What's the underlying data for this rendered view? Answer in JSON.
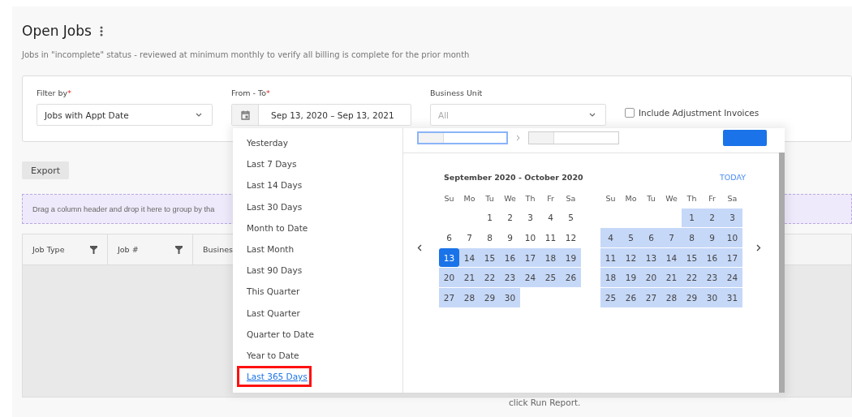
{
  "title": "Open Jobs",
  "subtitle": "Jobs in \"incomplete\" status - reviewed at minimum monthly to verify all billing is complete for the prior month",
  "filters": [
    {
      "label": "Filter by",
      "required": true,
      "kind": "select",
      "value": "Jobs with Appt Date"
    },
    {
      "label": "From - To",
      "required": true,
      "kind": "daterange",
      "value": "Sep 13, 2020 – Sep 13, 2021"
    },
    {
      "label": "Business Unit",
      "required": false,
      "kind": "select",
      "placeholder": "All"
    }
  ],
  "required_mark": "*",
  "include_adjustment": {
    "label": "Include Adjustment Invoices",
    "checked": false
  },
  "export_button": "Export",
  "group_panel": "Drag a column header and drop it here to group by tha",
  "columns": [
    {
      "label": "Job Type",
      "filter": true
    },
    {
      "label": "Job #",
      "filter": true
    },
    {
      "label": "Busines",
      "filter": false
    }
  ],
  "empty_message": "click Run Report.",
  "presets": [
    {
      "label": "Yesterday",
      "selected": false,
      "highlighted": false
    },
    {
      "label": "Last 7 Days",
      "selected": false,
      "highlighted": false
    },
    {
      "label": "Last 14 Days",
      "selected": false,
      "highlighted": false
    },
    {
      "label": "Last 30 Days",
      "selected": false,
      "highlighted": false
    },
    {
      "label": "Month to Date",
      "selected": false,
      "highlighted": false
    },
    {
      "label": "Last Month",
      "selected": false,
      "highlighted": false
    },
    {
      "label": "Last 90 Days",
      "selected": false,
      "highlighted": false
    },
    {
      "label": "This Quarter",
      "selected": false,
      "highlighted": false
    },
    {
      "label": "Last Quarter",
      "selected": false,
      "highlighted": false
    },
    {
      "label": "Quarter to Date",
      "selected": false,
      "highlighted": false
    },
    {
      "label": "Year to Date",
      "selected": false,
      "highlighted": false
    },
    {
      "label": "Last 365 Days",
      "selected": true,
      "highlighted": true
    }
  ],
  "calendar": {
    "range_title": "September 2020 - October 2020",
    "today": "TODAY",
    "months": [
      {
        "weekdays": [
          "Su",
          "Mo",
          "Tu",
          "We",
          "Th",
          "Fr",
          "Sa"
        ],
        "weeks": [
          {
            "kind": "leading",
            "days": [
              {
                "day": "1",
                "in_range": false,
                "selected": false
              },
              {
                "day": "2",
                "in_range": false,
                "selected": false
              },
              {
                "day": "3",
                "in_range": false,
                "selected": false
              },
              {
                "day": "4",
                "in_range": false,
                "selected": false
              },
              {
                "day": "5",
                "in_range": false,
                "selected": false
              }
            ]
          },
          {
            "days": [
              {
                "day": "6",
                "in_range": false,
                "selected": false
              },
              {
                "day": "7",
                "in_range": false,
                "selected": false
              },
              {
                "day": "8",
                "in_range": false,
                "selected": false
              },
              {
                "day": "9",
                "in_range": false,
                "selected": false
              },
              {
                "day": "10",
                "in_range": false,
                "selected": false
              },
              {
                "day": "11",
                "in_range": false,
                "selected": false
              },
              {
                "day": "12",
                "in_range": false,
                "selected": false
              }
            ]
          },
          {
            "days": [
              {
                "day": "13",
                "in_range": true,
                "selected": true
              },
              {
                "day": "14",
                "in_range": true,
                "selected": false
              },
              {
                "day": "15",
                "in_range": true,
                "selected": false
              },
              {
                "day": "16",
                "in_range": true,
                "selected": false
              },
              {
                "day": "17",
                "in_range": true,
                "selected": false
              },
              {
                "day": "18",
                "in_range": true,
                "selected": false
              },
              {
                "day": "19",
                "in_range": true,
                "selected": false
              }
            ]
          },
          {
            "days": [
              {
                "day": "20",
                "in_range": true,
                "selected": false
              },
              {
                "day": "21",
                "in_range": true,
                "selected": false
              },
              {
                "day": "22",
                "in_range": true,
                "selected": false
              },
              {
                "day": "23",
                "in_range": true,
                "selected": false
              },
              {
                "day": "24",
                "in_range": true,
                "selected": false
              },
              {
                "day": "25",
                "in_range": true,
                "selected": false
              },
              {
                "day": "26",
                "in_range": true,
                "selected": false
              }
            ]
          },
          {
            "kind": "trailing",
            "days": [
              {
                "day": "27",
                "in_range": true,
                "selected": false
              },
              {
                "day": "28",
                "in_range": true,
                "selected": false
              },
              {
                "day": "29",
                "in_range": true,
                "selected": false
              },
              {
                "day": "30",
                "in_range": true,
                "selected": false
              }
            ]
          }
        ]
      },
      {
        "weekdays": [
          "Su",
          "Mo",
          "Tu",
          "We",
          "Th",
          "Fr",
          "Sa"
        ],
        "weeks": [
          {
            "kind": "leading",
            "days": [
              {
                "day": "1",
                "in_range": true,
                "selected": false
              },
              {
                "day": "2",
                "in_range": true,
                "selected": false
              },
              {
                "day": "3",
                "in_range": true,
                "selected": false
              }
            ]
          },
          {
            "days": [
              {
                "day": "4",
                "in_range": true,
                "selected": false
              },
              {
                "day": "5",
                "in_range": true,
                "selected": false
              },
              {
                "day": "6",
                "in_range": true,
                "selected": false
              },
              {
                "day": "7",
                "in_range": true,
                "selected": false
              },
              {
                "day": "8",
                "in_range": true,
                "selected": false
              },
              {
                "day": "9",
                "in_range": true,
                "selected": false
              },
              {
                "day": "10",
                "in_range": true,
                "selected": false
              }
            ]
          },
          {
            "days": [
              {
                "day": "11",
                "in_range": true,
                "selected": false
              },
              {
                "day": "12",
                "in_range": true,
                "selected": false
              },
              {
                "day": "13",
                "in_range": true,
                "selected": false
              },
              {
                "day": "14",
                "in_range": true,
                "selected": false
              },
              {
                "day": "15",
                "in_range": true,
                "selected": false
              },
              {
                "day": "16",
                "in_range": true,
                "selected": false
              },
              {
                "day": "17",
                "in_range": true,
                "selected": false
              }
            ]
          },
          {
            "days": [
              {
                "day": "18",
                "in_range": true,
                "selected": false
              },
              {
                "day": "19",
                "in_range": true,
                "selected": false
              },
              {
                "day": "20",
                "in_range": true,
                "selected": false
              },
              {
                "day": "21",
                "in_range": true,
                "selected": false
              },
              {
                "day": "22",
                "in_range": true,
                "selected": false
              },
              {
                "day": "23",
                "in_range": true,
                "selected": false
              },
              {
                "day": "24",
                "in_range": true,
                "selected": false
              }
            ]
          },
          {
            "days": [
              {
                "day": "25",
                "in_range": true,
                "selected": false
              },
              {
                "day": "26",
                "in_range": true,
                "selected": false
              },
              {
                "day": "27",
                "in_range": true,
                "selected": false
              },
              {
                "day": "28",
                "in_range": true,
                "selected": false
              },
              {
                "day": "29",
                "in_range": true,
                "selected": false
              },
              {
                "day": "30",
                "in_range": true,
                "selected": false
              },
              {
                "day": "31",
                "in_range": true,
                "selected": false
              }
            ]
          }
        ]
      }
    ]
  }
}
